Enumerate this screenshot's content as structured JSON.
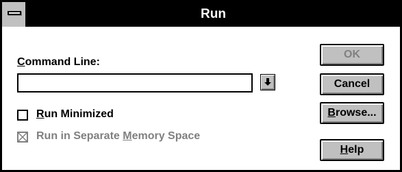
{
  "window": {
    "title": "Run"
  },
  "command_line": {
    "label_accel": "C",
    "label_rest": "ommand Line:",
    "value": ""
  },
  "options": {
    "run_minimized": {
      "label_accel": "R",
      "label_rest": "un Minimized",
      "checked": false,
      "enabled": true
    },
    "separate_memory": {
      "label_pre": "Run in Separate ",
      "label_accel": "M",
      "label_rest": "emory Space",
      "checked": true,
      "enabled": false
    }
  },
  "buttons": {
    "ok": "OK",
    "cancel": "Cancel",
    "browse_accel": "B",
    "browse_rest": "rowse...",
    "help_accel": "H",
    "help_rest": "elp"
  },
  "icons": {
    "system_menu": "system-menu-icon",
    "dropdown": "dropdown-arrow-icon",
    "checkbox_x": "checkbox-x-icon"
  },
  "colors": {
    "titlebar": "#000000",
    "button_face": "#c0c0c0",
    "disabled_text": "#808080"
  }
}
